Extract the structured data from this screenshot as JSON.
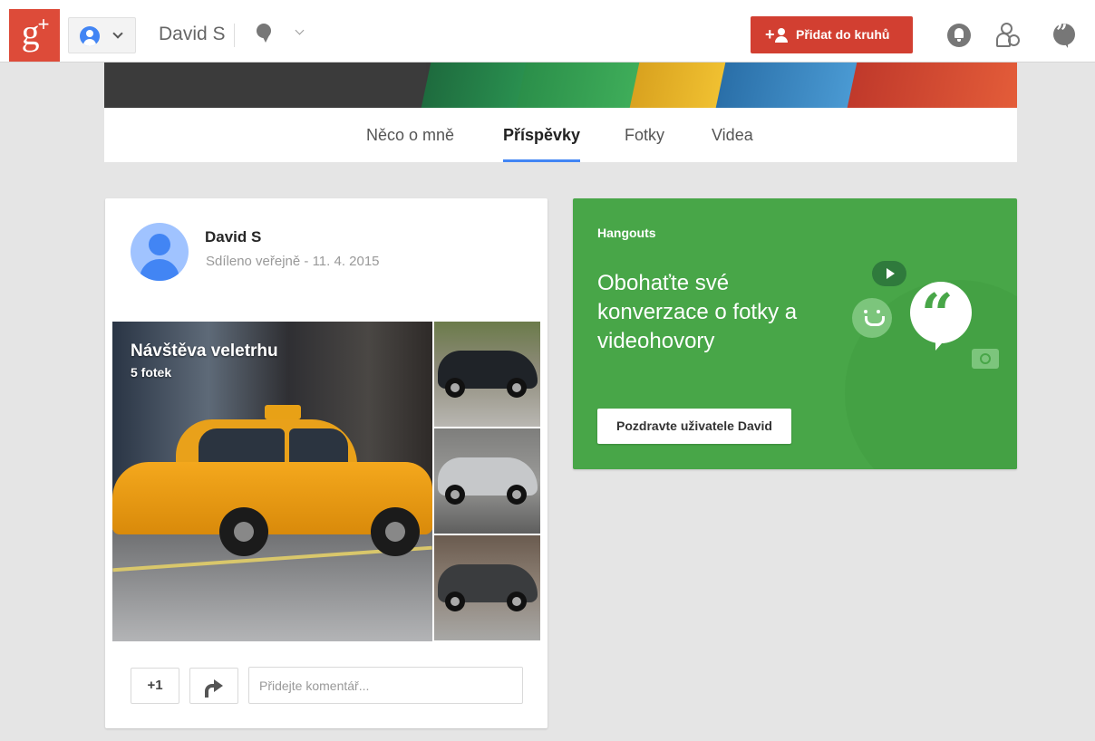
{
  "topbar": {
    "logo_text": "g",
    "logo_plus": "+",
    "profile_name": "David S",
    "add_to_circles_label": "Přidat do kruhů"
  },
  "tabs": [
    {
      "label": "Něco o mně",
      "active": false
    },
    {
      "label": "Příspěvky",
      "active": true
    },
    {
      "label": "Fotky",
      "active": false
    },
    {
      "label": "Videa",
      "active": false
    }
  ],
  "post": {
    "author": "David S",
    "meta": "Sdíleno veřejně  -  11. 4. 2015",
    "album_title": "Návštěva veletrhu",
    "album_count": "5 fotek",
    "plus_one_label": "+1",
    "comment_placeholder": "Přidejte komentář..."
  },
  "hangouts": {
    "label": "Hangouts",
    "headline": "Obohaťte své konverzace o fotky a videohovory",
    "button_label": "Pozdravte uživatele David"
  },
  "colors": {
    "brand_red": "#dd4b39",
    "add_button": "#d23f31",
    "hangouts_green": "#48a648",
    "tab_underline": "#4285f4",
    "background": "#e5e5e5"
  },
  "icons": [
    "google-plus-logo",
    "account-icon",
    "chevron-down-icon",
    "thought-bubble-icon",
    "person-add-icon",
    "notifications-bell-icon",
    "circles-icon",
    "hangouts-icon",
    "share-icon",
    "smiley-bubble-icon",
    "play-bubble-icon",
    "camera-icon"
  ]
}
